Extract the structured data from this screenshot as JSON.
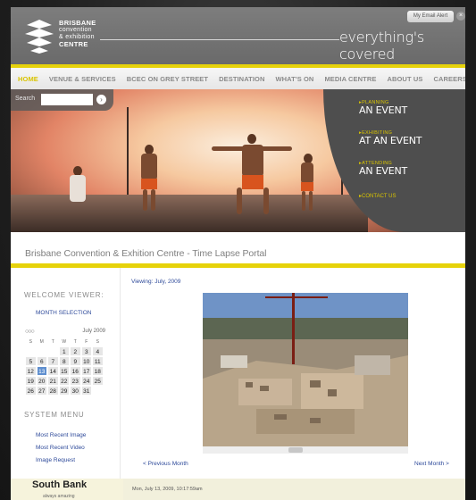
{
  "header": {
    "logo_lines": [
      "BRISBANE",
      "convention",
      "& exhibition",
      "CENTRE"
    ],
    "tagline": "everything's covered",
    "email_button": "My Email Alert",
    "close_button": "×"
  },
  "nav": {
    "items": [
      "HOME",
      "VENUE & SERVICES",
      "BCEC ON GREY STREET",
      "DESTINATION",
      "WHAT'S ON",
      "MEDIA CENTRE",
      "ABOUT US",
      "CAREERS"
    ],
    "active_index": 0
  },
  "search": {
    "label": "Search",
    "go": "›"
  },
  "events": [
    {
      "small": "PLANNING",
      "big": "AN EVENT"
    },
    {
      "small": "EXHIBITING",
      "big": "AT AN EVENT"
    },
    {
      "small": "ATTENDING",
      "big": "AN EVENT"
    }
  ],
  "contact": "CONTACT US",
  "portal_title": "Brisbane Convention & Exhition Centre - Time Lapse Portal",
  "sidebar": {
    "welcome": "WELCOME VIEWER:",
    "month_selection": "MONTH SELECTION",
    "calendar": {
      "controls": "○○○",
      "month": "July 2009",
      "dows": [
        "S",
        "M",
        "T",
        "W",
        "T",
        "F",
        "S"
      ],
      "weeks": [
        [
          "",
          "",
          "",
          "1",
          "2",
          "3",
          "4"
        ],
        [
          "5",
          "6",
          "7",
          "8",
          "9",
          "10",
          "11"
        ],
        [
          "12",
          "13",
          "14",
          "15",
          "16",
          "17",
          "18"
        ],
        [
          "19",
          "20",
          "21",
          "22",
          "23",
          "24",
          "25"
        ],
        [
          "26",
          "27",
          "28",
          "29",
          "30",
          "31",
          ""
        ]
      ],
      "selected_day": "13"
    },
    "system_menu": "SYSTEM MENU",
    "links": [
      "Most Recent Image",
      "Most Recent Video",
      "Image Request"
    ]
  },
  "main": {
    "viewing": "Viewing: July, 2009",
    "prev": "<   Previous Month",
    "next": "Next Month   >",
    "slider_position": 0.45,
    "date": "Mon, July 13, 2009, 10:17:59am"
  },
  "footer": {
    "brand": "South Bank",
    "brand_sub": "always amazing"
  },
  "colors": {
    "accent": "#e6d20a",
    "link": "#2e4a9a",
    "header": "#6e6e6e",
    "panel": "#4e4e4e",
    "selected_day": "#5f8fcf"
  }
}
